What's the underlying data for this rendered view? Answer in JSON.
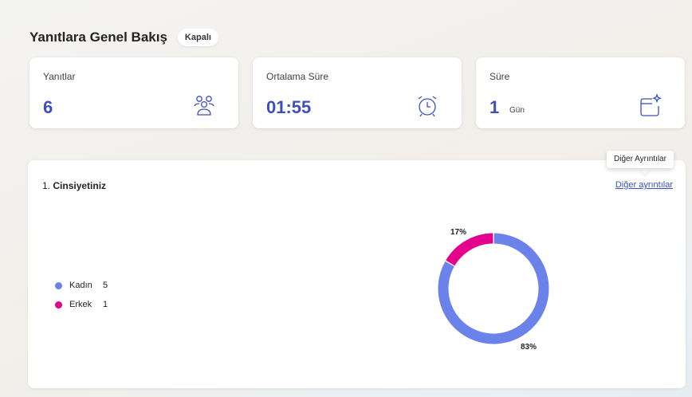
{
  "header": {
    "title": "Yanıtlara Genel Bakış",
    "status": "Kapalı"
  },
  "cards": [
    {
      "label": "Yanıtlar",
      "value": "6",
      "icon": "people-icon"
    },
    {
      "label": "Ortalama Süre",
      "value": "01:55",
      "icon": "alarm-clock-icon"
    },
    {
      "label": "Süre",
      "value": "1",
      "unit": "Gün",
      "icon": "calendar-sparkle-icon"
    }
  ],
  "question": {
    "number": "1.",
    "title": "Cinsiyetiniz",
    "details_link": "Diğer ayrıntılar",
    "tooltip": "Diğer Ayrıntılar"
  },
  "colors": {
    "accent": "#3b4fbd",
    "kadin": "#6b82ea",
    "erkek": "#e3008c"
  },
  "chart_data": {
    "type": "pie",
    "categories": [
      "Kadın",
      "Erkek"
    ],
    "values": [
      5,
      1
    ],
    "percent_labels": [
      "83%",
      "17%"
    ],
    "legend": "left"
  }
}
